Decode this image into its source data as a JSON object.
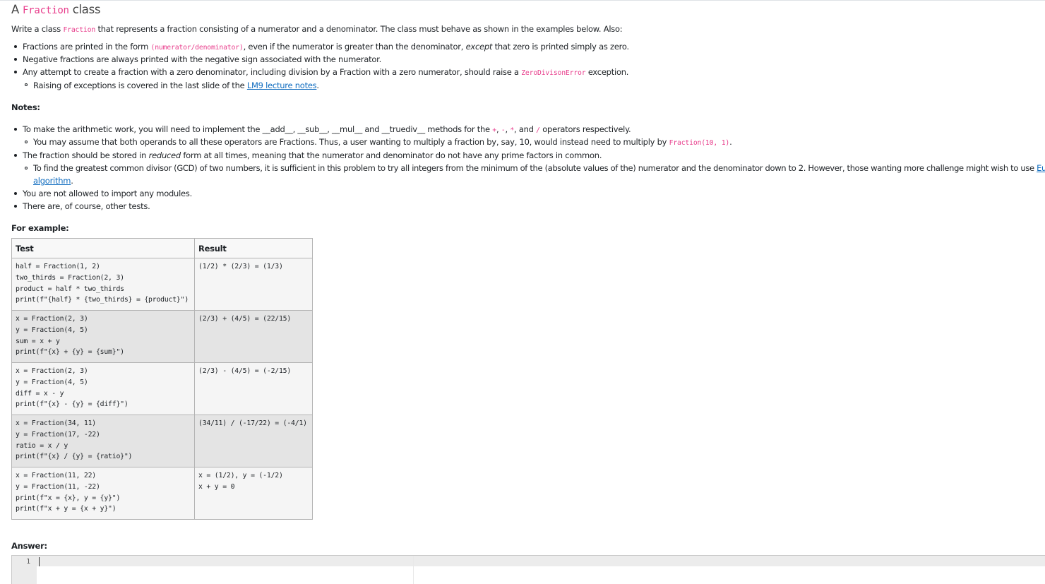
{
  "title": {
    "prefix": "A",
    "code": "Fraction",
    "suffix": "class"
  },
  "intro": {
    "a": "Write a class",
    "code": "Fraction",
    "b": "that represents a fraction consisting of a numerator and a denominator. The class must behave as shown in the examples below. Also:"
  },
  "bullets": {
    "b1": {
      "a": "Fractions are printed in the form",
      "code": "(numerator/denominator)",
      "b": ", even if the numerator is greater than the denominator,",
      "em": "except",
      "c": "that zero is printed simply as zero."
    },
    "b2": "Negative fractions are always printed with the negative sign associated with the numerator.",
    "b3": {
      "a": "Any attempt to create a fraction with a zero denominator, including division by a Fraction with a zero numerator, should raise a",
      "code": "ZeroDivisonError",
      "b": "exception."
    },
    "b3a": {
      "a": "Raising of exceptions is covered in the last slide of the",
      "link": "LM9 lecture notes",
      "b": "."
    }
  },
  "notes_heading": "Notes:",
  "notes": {
    "n1": {
      "a": "To make the arithmetic work, you will need to implement the",
      "m1": "__add__",
      "s1": ",",
      "m2": "__sub__",
      "s2": ",",
      "m3": "__mul__",
      "s3": "and",
      "m4": "__truediv__",
      "b": "methods for the",
      "o1": "+",
      "c1": ",",
      "o2": "-",
      "c2": ",",
      "o3": "*",
      "c3": ", and",
      "o4": "/",
      "c": "operators respectively."
    },
    "n1a": {
      "a": "You may assume that both operands to all these operators are Fractions. Thus, a user wanting to multiply a fraction by, say, 10, would instead need to multiply by",
      "code": "Fraction(10, 1)",
      "b": "."
    },
    "n2": {
      "a": "The fraction should be stored in",
      "em": "reduced",
      "b": "form at all times, meaning that the numerator and denominator do not have any prime factors in common."
    },
    "n2a": {
      "a": "To find the greatest common divisor (GCD) of two numbers, it is sufficient in this problem to try all integers from the minimum of the (absolute values of the) numerator and the denominator down to 2. However, those wanting more challenge might wish to use",
      "link1": "Euclid's",
      "link2": "algorithm",
      "b": "."
    },
    "n3": "You are not allowed to import any modules.",
    "n4": "There are, of course, other tests."
  },
  "example_heading": "For example:",
  "table": {
    "headers": {
      "test": "Test",
      "result": "Result"
    },
    "rows": [
      {
        "test": [
          "half = Fraction(1, 2)",
          "two_thirds = Fraction(2, 3)",
          "product = half * two_thirds",
          "print(f\"{half} * {two_thirds} = {product}\")"
        ],
        "result": [
          "(1/2) * (2/3) = (1/3)"
        ]
      },
      {
        "test": [
          "x = Fraction(2, 3)",
          "y = Fraction(4, 5)",
          "sum = x + y",
          "print(f\"{x} + {y} = {sum}\")"
        ],
        "result": [
          "(2/3) + (4/5) = (22/15)"
        ]
      },
      {
        "test": [
          "x = Fraction(2, 3)",
          "y = Fraction(4, 5)",
          "diff = x - y",
          "print(f\"{x} - {y} = {diff}\")"
        ],
        "result": [
          "(2/3) - (4/5) = (-2/15)"
        ]
      },
      {
        "test": [
          "x = Fraction(34, 11)",
          "y = Fraction(17, -22)",
          "ratio = x / y",
          "print(f\"{x} / {y} = {ratio}\")"
        ],
        "result": [
          "(34/11) / (-17/22) = (-4/1)"
        ]
      },
      {
        "test": [
          "x = Fraction(11, 22)",
          "y = Fraction(11, -22)",
          "print(f\"x = {x}, y = {y}\")",
          "print(f\"x + y = {x + y}\")"
        ],
        "result": [
          "x = (1/2), y = (-1/2)",
          "x + y = 0"
        ]
      }
    ]
  },
  "answer_heading": "Answer:",
  "editor": {
    "line_number": "1",
    "content": ""
  }
}
